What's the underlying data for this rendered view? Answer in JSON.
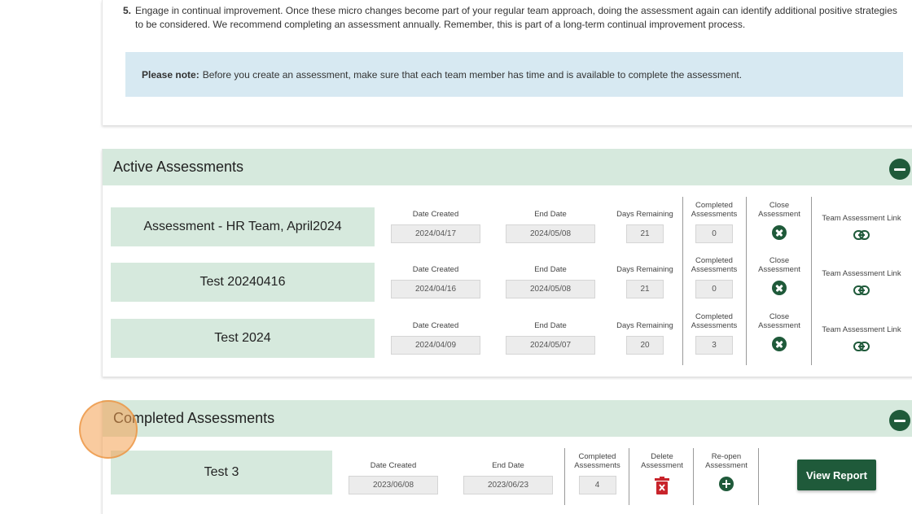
{
  "intro": {
    "step5_number": "5.",
    "step5_text": "Engage in continual improvement. Once these micro changes become part of your regular team approach, doing the assessment again can identify additional positive strategies to be considered. We recommend completing an assessment annually. Remember, this is part of a long-term continual improvement process.",
    "note_label": "Please note:",
    "note_text": "Before you create an assessment, make sure that each team member has time and is available to complete the assessment."
  },
  "active": {
    "title": "Active Assessments",
    "labels": {
      "date_created": "Date Created",
      "end_date": "End Date",
      "days_remaining": "Days Remaining",
      "completed_1": "Completed",
      "completed_2": "Assessments",
      "close_1": "Close",
      "close_2": "Assessment",
      "link": "Team Assessment Link"
    },
    "rows": [
      {
        "name": "Assessment - HR Team, April2024",
        "date_created": "2024/04/17",
        "end_date": "2024/05/08",
        "days_remaining": "21",
        "completed": "0"
      },
      {
        "name": "Test 20240416",
        "date_created": "2024/04/16",
        "end_date": "2024/05/08",
        "days_remaining": "21",
        "completed": "0"
      },
      {
        "name": "Test 2024",
        "date_created": "2024/04/09",
        "end_date": "2024/05/07",
        "days_remaining": "20",
        "completed": "3"
      }
    ]
  },
  "completed": {
    "title": "Completed Assessments",
    "labels": {
      "date_created": "Date Created",
      "end_date": "End Date",
      "completed_1": "Completed",
      "completed_2": "Assessments",
      "delete_1": "Delete",
      "delete_2": "Assessment",
      "reopen_1": "Re-open",
      "reopen_2": "Assessment",
      "view_report": "View Report"
    },
    "rows": [
      {
        "name": "Test 3",
        "date_created": "2023/06/08",
        "end_date": "2023/06/23",
        "completed": "4"
      }
    ]
  },
  "colors": {
    "accent_dark_green": "#1f5a3a",
    "section_header_bg": "#d6e9dd",
    "note_bg": "#d7e9f2",
    "delete_red": "#c8242b"
  },
  "icons": [
    "collapse-icon",
    "close-icon",
    "link-icon",
    "trash-icon",
    "plus-icon"
  ]
}
